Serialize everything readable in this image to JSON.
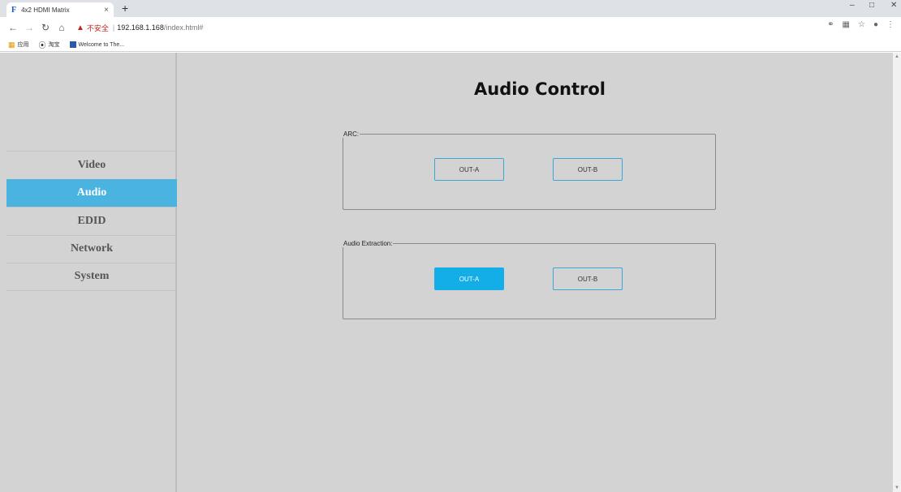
{
  "browser": {
    "tab_title": "4x2 HDMI Matrix",
    "tab_favicon": "F",
    "tab_close": "×",
    "new_tab": "+",
    "security_label": "不安全",
    "url_host": "192.168.1.168",
    "url_path": "/index.html#",
    "bookmarks": [
      {
        "label": "应用",
        "icon": "apps-grid-icon"
      },
      {
        "label": "淘宝",
        "icon": "compass-icon"
      },
      {
        "label": "Welcome to The...",
        "icon": "site-icon"
      }
    ]
  },
  "sidebar": {
    "items": [
      {
        "label": "Video",
        "active": false
      },
      {
        "label": "Audio",
        "active": true
      },
      {
        "label": "EDID",
        "active": false
      },
      {
        "label": "Network",
        "active": false
      },
      {
        "label": "System",
        "active": false
      }
    ]
  },
  "main": {
    "title": "Audio Control",
    "arc": {
      "legend": "ARC:",
      "buttons": [
        {
          "label": "OUT-A",
          "active": false
        },
        {
          "label": "OUT-B",
          "active": false
        }
      ]
    },
    "extraction": {
      "legend": "Audio Extraction:",
      "buttons": [
        {
          "label": "OUT-A",
          "active": true
        },
        {
          "label": "OUT-B",
          "active": false
        }
      ]
    }
  },
  "colors": {
    "accent": "#4ab3e0",
    "button_active": "#13aee8",
    "page_bg": "#d3d3d3"
  }
}
